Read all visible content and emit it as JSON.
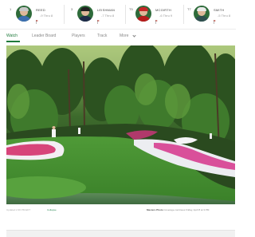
{
  "leaderboard": {
    "players": [
      {
        "pos": "1",
        "name": "REED",
        "score": "-9 Thru 8",
        "cap_color": "#c8c8c8",
        "shirt_color": "#3d6fb0",
        "flag_color": "#c0392b"
      },
      {
        "pos": "3",
        "name": "LEISHMAN",
        "score": "-7 Thru 8",
        "cap_color": "#222222",
        "shirt_color": "#1e2b48",
        "flag_color": "#c0392b"
      },
      {
        "pos": "T5",
        "name": "MCGIRTH",
        "score": "-6 Thru 9",
        "cap_color": "#c62828",
        "shirt_color": "#b71c1c",
        "flag_color": "#c0392b"
      },
      {
        "pos": "T7",
        "name": "SMITH",
        "score": "-5 Thru 8",
        "cap_color": "#eaeaea",
        "shirt_color": "#2f4f4f",
        "flag_color": "#c0392b"
      }
    ]
  },
  "tabs": {
    "watch": "Watch",
    "leaderboard": "Leader Board",
    "players": "Players",
    "track": "Track",
    "more": "More"
  },
  "caption": {
    "left": "Updated 2:36 PM EDT",
    "link": "Collapse",
    "right_bold": "Masters Photo",
    "right": "Coverage continues Friday, April 8 at 3 PM"
  },
  "colors": {
    "accent": "#1f7a3c"
  }
}
